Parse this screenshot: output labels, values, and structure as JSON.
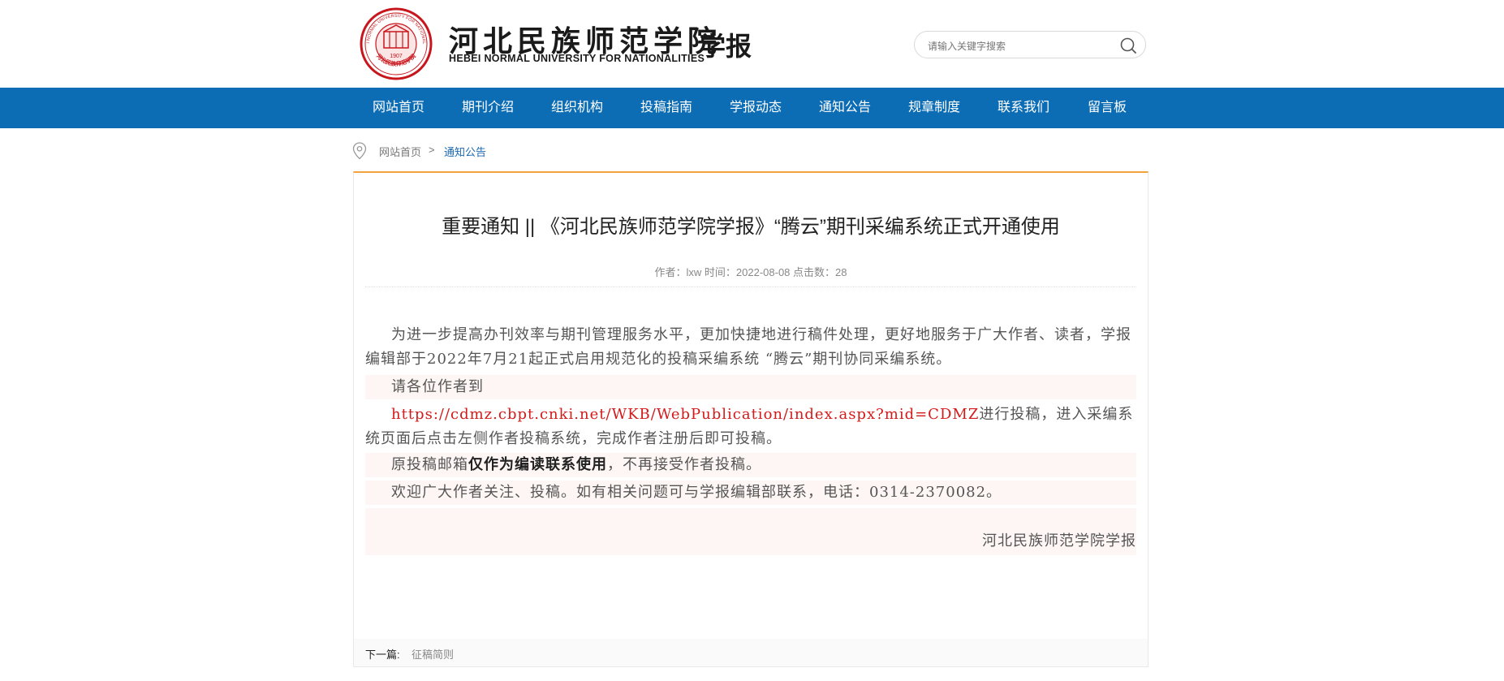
{
  "header": {
    "logo_title_cn": "河北民族师范学院",
    "logo_title_en": "HEBEI NORMAL UNIVERSITY FOR NATIONALITIES",
    "logo_sub": "学报",
    "seal_ring_text": "HEBEI NORMAL UNIVERSITY FOR NATIONALITIES",
    "seal_year": "1907",
    "seal_bottom_text": "河北民族师范学院",
    "search_placeholder": "请输入关键字搜索"
  },
  "nav": {
    "items": [
      "网站首页",
      "期刊介绍",
      "组织机构",
      "投稿指南",
      "学报动态",
      "通知公告",
      "规章制度",
      "联系我们",
      "留言板"
    ]
  },
  "breadcrumb": {
    "home": "网站首页",
    "separator": ">",
    "current": "通知公告"
  },
  "article": {
    "title": "重要通知 || 《河北民族师范学院学报》“腾云”期刊采编系统正式开通使用",
    "meta": "作者：lxw 时间：2022-08-08 点击数：28",
    "p1": "为进一步提高办刊效率与期刊管理服务水平，更加快捷地进行稿件处理，更好地服务于广大作者、读者，学报编辑部于2022年7月21起正式启用规范化的投稿采编系统 “腾云”期刊协同采编系统。",
    "p2": "请各位作者到",
    "p3_link": "https://cdmz.cbpt.cnki.net/WKB/WebPublication/index.aspx?mid=CDMZ",
    "p3_rest": "进行投稿，进入采编系统页面后点击左侧作者投稿系统，完成作者注册后即可投稿。",
    "p4_pre": "原投稿邮箱",
    "p4_bold": "仅作为编读联系使用",
    "p4_post": "，不再接受作者投稿。",
    "p5": "欢迎广大作者关注、投稿。如有相关问题可与学报编辑部联系，电话：0314-2370082。",
    "signature": "河北民族师范学院学报"
  },
  "pager": {
    "next_label": "下一篇:",
    "next_title": "征稿简则"
  },
  "colors": {
    "nav_bg": "#0c6db5",
    "accent_line": "#f3a33c",
    "link_red": "#d21a1a",
    "crumb_blue": "#1a67b0",
    "seal_red": "#c8161d"
  }
}
